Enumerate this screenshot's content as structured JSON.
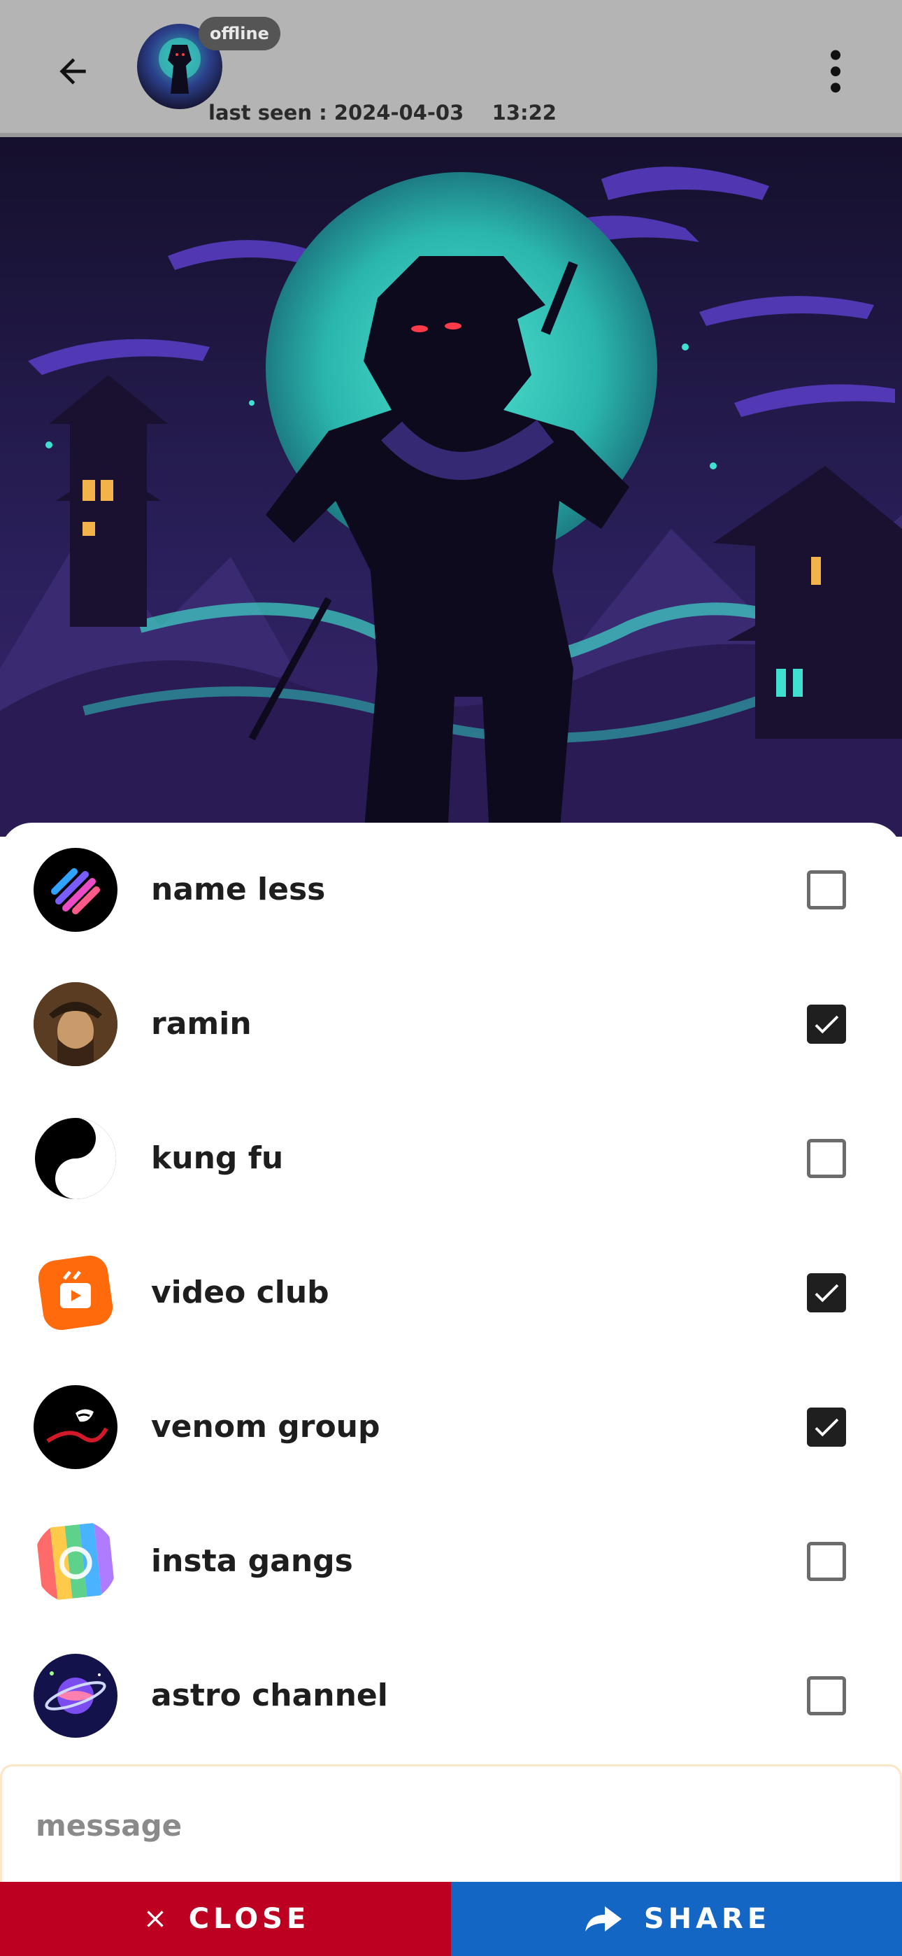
{
  "header": {
    "status_badge": "offline",
    "last_seen": "last seen : 2024-04-03    13:22",
    "back_icon": "arrow-left-icon",
    "menu_icon": "more-vertical-icon"
  },
  "share_list": [
    {
      "name": "name less",
      "checked": false
    },
    {
      "name": "ramin",
      "checked": true
    },
    {
      "name": "kung fu",
      "checked": false
    },
    {
      "name": "video club",
      "checked": true
    },
    {
      "name": "venom group",
      "checked": true
    },
    {
      "name": "insta gangs",
      "checked": false
    },
    {
      "name": "astro channel",
      "checked": false
    }
  ],
  "message": {
    "placeholder": "message",
    "value": ""
  },
  "actions": {
    "close_label": "CLOSE",
    "share_label": "SHARE"
  },
  "colors": {
    "header_bg": "#b4b4b4",
    "close_bg": "#bd0021",
    "share_bg": "#1466c4",
    "checkbox_checked": "#1f1f1f"
  }
}
